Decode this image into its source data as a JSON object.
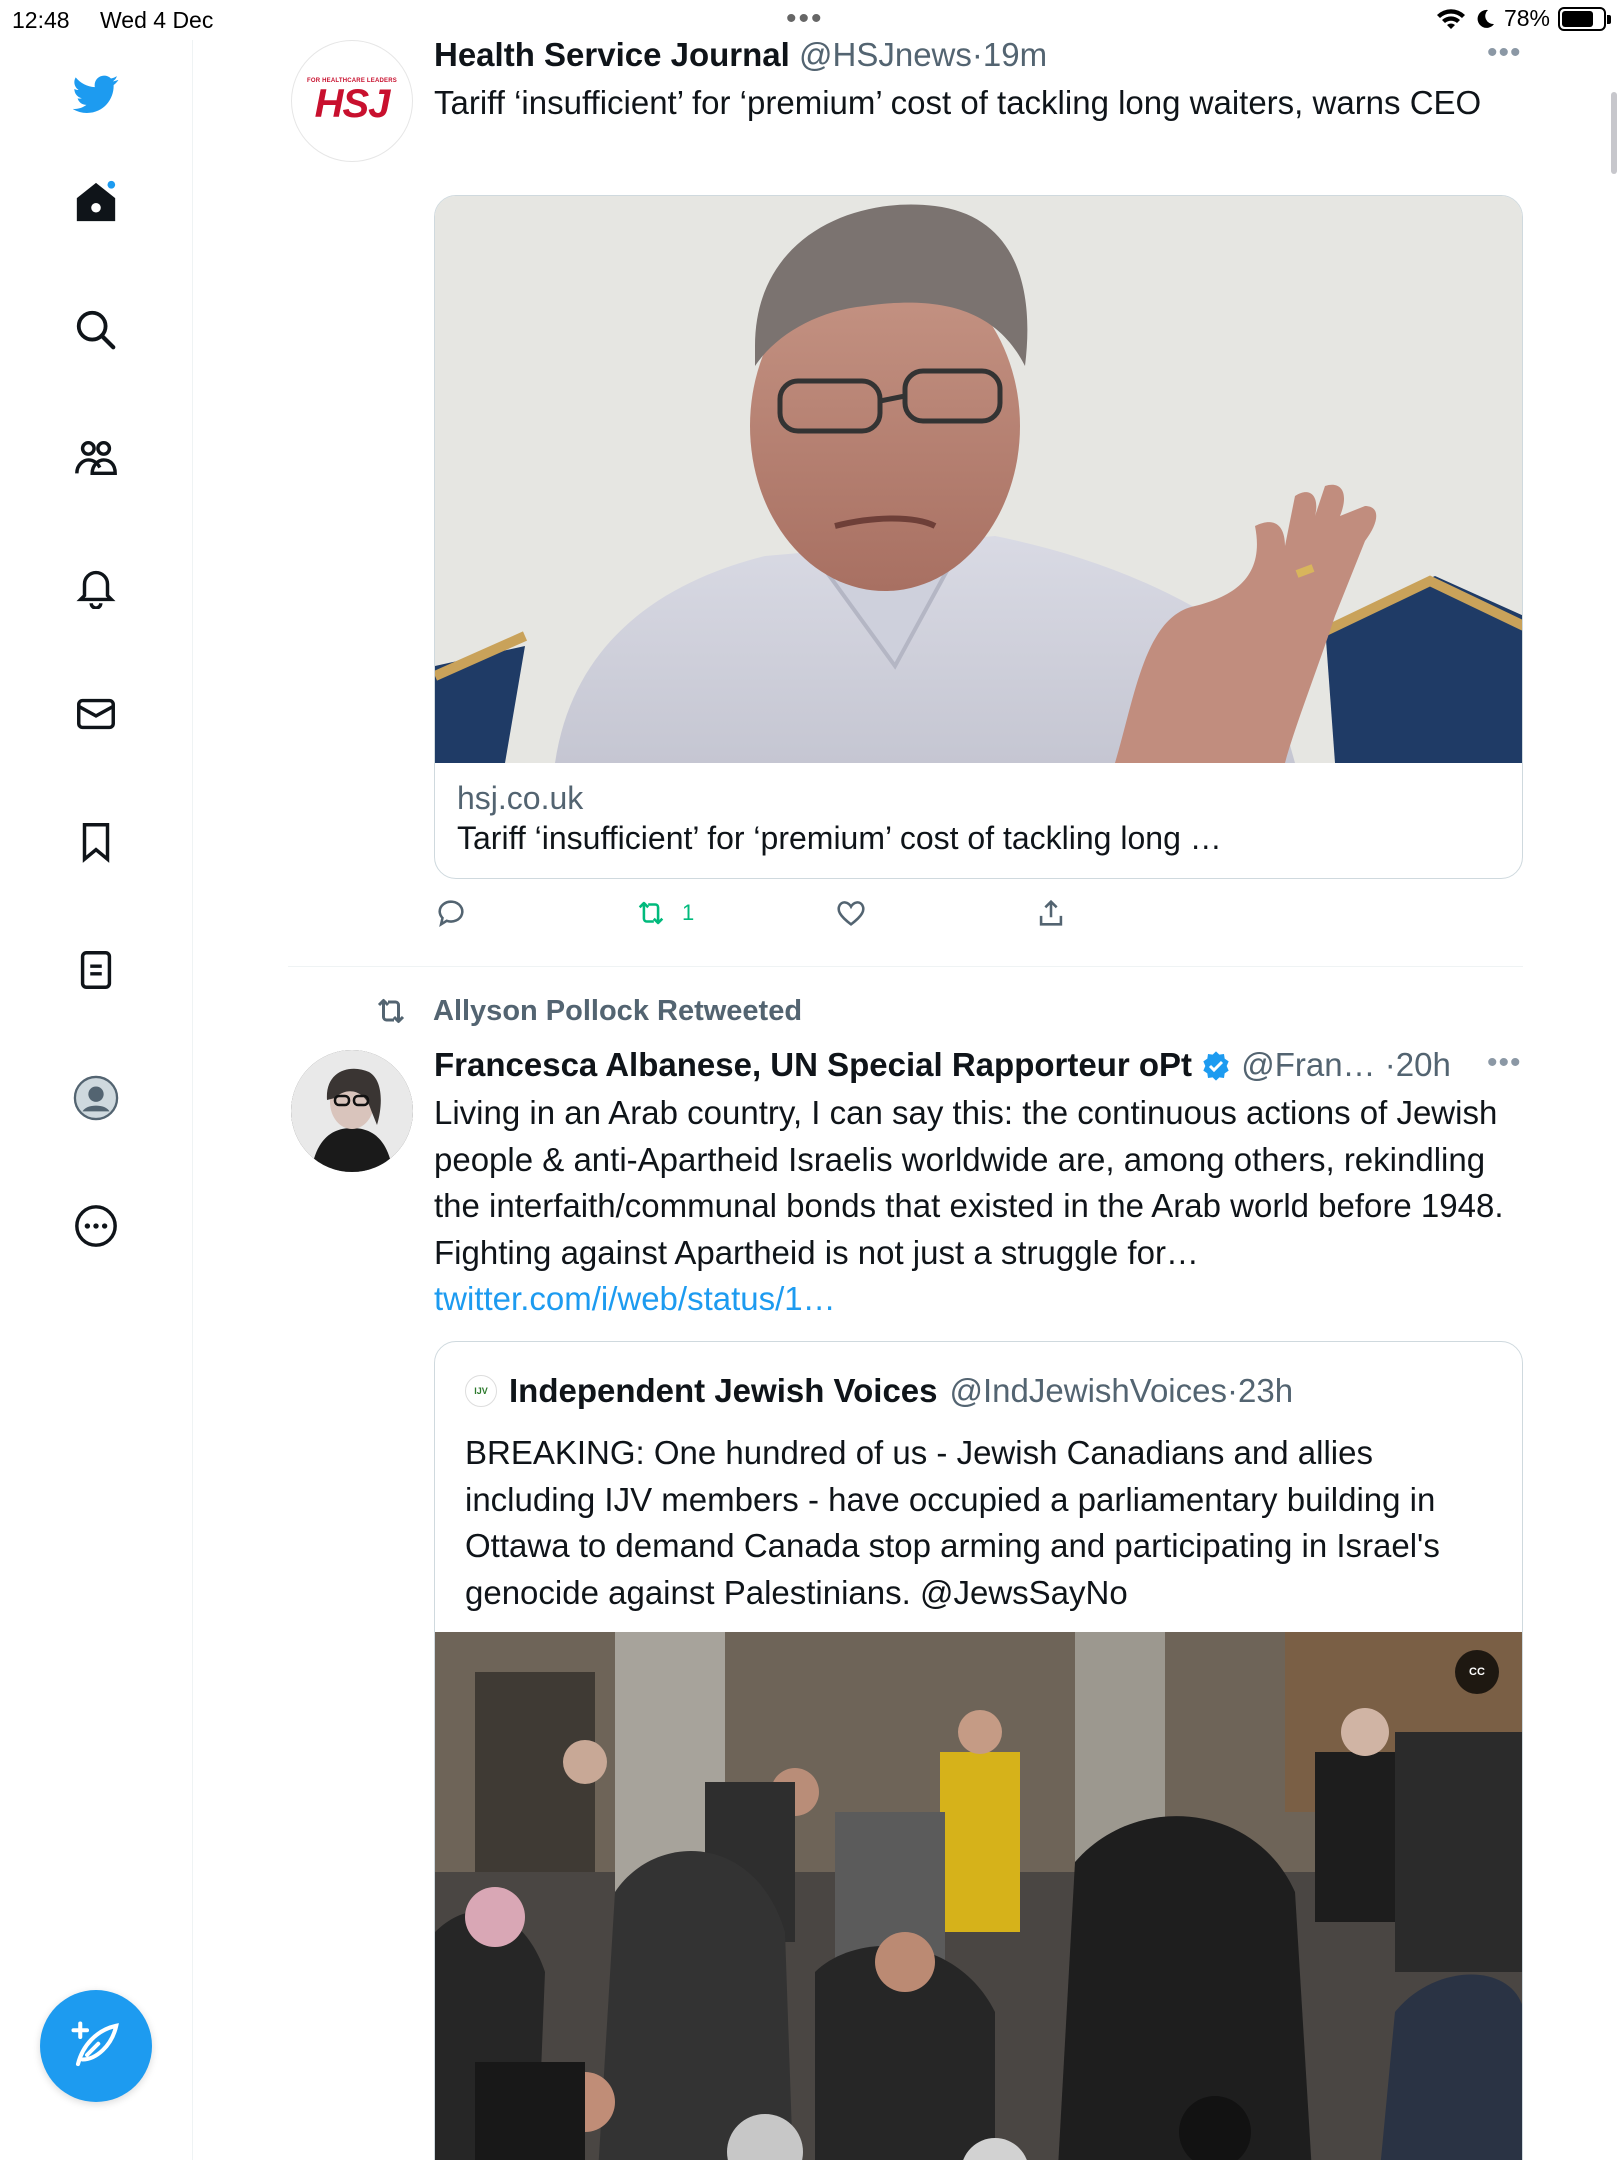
{
  "status_bar": {
    "time": "12:48",
    "date": "Wed 4 Dec",
    "battery": "78%",
    "battery_level": 0.78
  },
  "sidebar": {
    "items": [
      {
        "icon": "twitter-bird-icon"
      },
      {
        "icon": "home-icon"
      },
      {
        "icon": "search-icon"
      },
      {
        "icon": "communities-icon"
      },
      {
        "icon": "notifications-icon"
      },
      {
        "icon": "messages-icon"
      },
      {
        "icon": "bookmarks-icon"
      },
      {
        "icon": "lists-icon"
      },
      {
        "icon": "profile-icon"
      },
      {
        "icon": "more-icon"
      }
    ],
    "compose_icon": "compose-feather-icon"
  },
  "colors": {
    "accent": "#1d9bf0",
    "retweet_green": "#00ba7c",
    "text": "#0f1419",
    "muted": "#536471"
  },
  "tweets": [
    {
      "avatar_text": "FOR HEALTHCARE LEADERS",
      "avatar_logo": "HSJ",
      "name": "Health Service Journal",
      "handle": "@HSJnews",
      "time": "19m",
      "text": "Tariff ‘insufficient’ for ‘premium’ cost of tackling long waiters, warns CEO",
      "card": {
        "domain": "hsj.co.uk",
        "title": "Tariff ‘insufficient’ for ‘premium’ cost of tackling long …"
      },
      "retweet_count": "1"
    },
    {
      "retweeted_by": "Allyson Pollock Retweeted",
      "name": "Francesca Albanese, UN Special Rapporteur oPt",
      "handle": "@Fran…",
      "time": "20h",
      "text": "Living in an Arab country, I can say this: the continuous actions of Jewish people & anti-Apartheid Israelis worldwide are, among others, rekindling the interfaith/communal bonds that existed in the Arab world before 1948. Fighting against Apartheid is not just a struggle for…",
      "link": "twitter.com/i/web/status/1…",
      "quote": {
        "logo_text": "IJV",
        "name": "Independent Jewish Voices",
        "handle": "@IndJewishVoices",
        "time": "23h",
        "text": "BREAKING: One hundred of us - Jewish Canadians and allies including IJV members - have occupied a parliamentary building in Ottawa to demand Canada stop arming and participating in Israel's genocide against Palestinians. @JewsSayNo",
        "cc_label": "CC"
      }
    }
  ],
  "separator": "·",
  "more": "•••"
}
